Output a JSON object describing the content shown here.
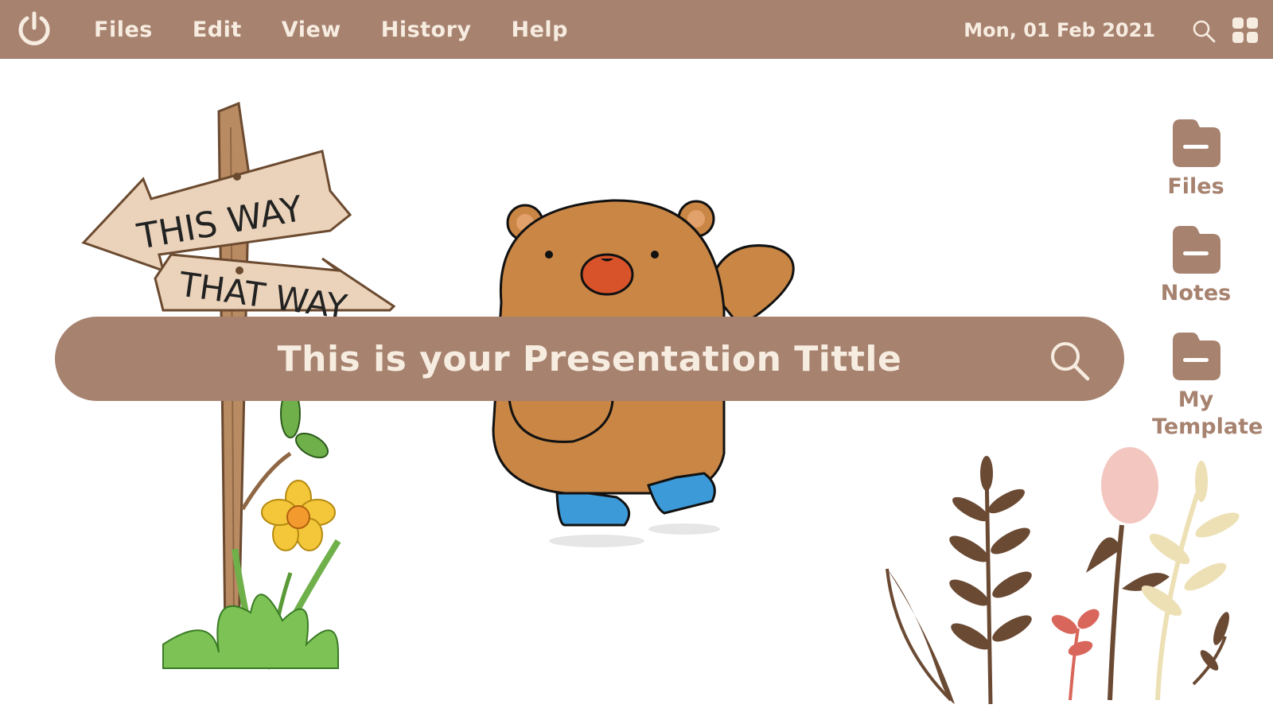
{
  "menu": {
    "items": [
      "Files",
      "Edit",
      "View",
      "History",
      "Help"
    ]
  },
  "status": {
    "date": "Mon, 01 Feb 2021"
  },
  "search": {
    "title": "This is your Presentation Tittle"
  },
  "sidebar": {
    "items": [
      {
        "label": "Files"
      },
      {
        "label": "Notes"
      },
      {
        "label": "My Template"
      }
    ]
  },
  "signpost": {
    "top_sign": "THIS WAY",
    "bottom_sign": "THAT WAY"
  },
  "colors": {
    "accent": "#a6826f",
    "accent_text": "#f7ece0",
    "background": "#ffffff"
  },
  "icons": [
    "power-icon",
    "search-icon",
    "apps-grid-icon",
    "folder-icon"
  ]
}
